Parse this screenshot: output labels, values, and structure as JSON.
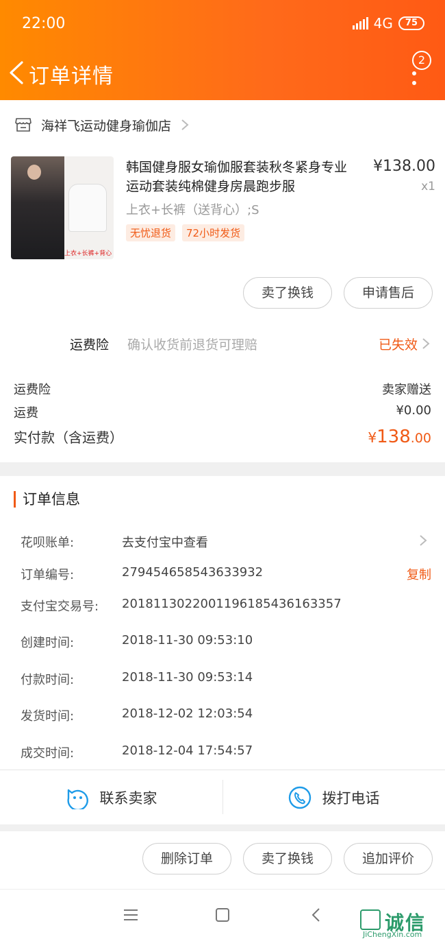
{
  "status_bar": {
    "time": "22:00",
    "network": "4G",
    "battery": "75"
  },
  "header": {
    "title": "订单详情",
    "menu_badge": "2"
  },
  "shop": {
    "name": "海祥飞运动健身瑜伽店"
  },
  "product": {
    "title": "韩国健身服女瑜伽服套装秋冬紧身专业运动套装纯棉健身房晨跑步服",
    "price": "¥138.00",
    "quantity": "x1",
    "spec": "上衣+长裤（送背心）;S",
    "tags": [
      "无忧退货",
      "72小时发货"
    ],
    "image_caption": "上衣+长裤+背心"
  },
  "product_actions": {
    "sell": "卖了换钱",
    "after_sale": "申请售后"
  },
  "insurance": {
    "label": "运费险",
    "desc": "确认收货前退货可理赔",
    "status": "已失效"
  },
  "fees": [
    {
      "label": "运费险",
      "value": "卖家赠送"
    },
    {
      "label": "运费",
      "value": "¥0.00"
    }
  ],
  "total": {
    "label": "实付款（含运费）",
    "currency": "¥",
    "integer": "138",
    "decimal": ".00"
  },
  "order_info": {
    "title": "订单信息",
    "huabei": {
      "label": "花呗账单:",
      "value": "去支付宝中查看"
    },
    "order_no": {
      "label": "订单编号:",
      "value": "279454658543633932",
      "action": "复制"
    },
    "alipay_no": {
      "label": "支付宝交易号:",
      "value": "2018113022001196185436163357"
    },
    "created": {
      "label": "创建时间:",
      "value": "2018-11-30 09:53:10"
    },
    "paid": {
      "label": "付款时间:",
      "value": "2018-11-30 09:53:14"
    },
    "shipped": {
      "label": "发货时间:",
      "value": "2018-12-02 12:03:54"
    },
    "completed": {
      "label": "成交时间:",
      "value": "2018-12-04 17:54:57"
    }
  },
  "contact": {
    "seller": "联系卖家",
    "call": "拨打电话"
  },
  "bottom_actions": {
    "delete": "删除订单",
    "sell": "卖了换钱",
    "review": "追加评价"
  },
  "watermark": {
    "text": "诚信",
    "url": "JiChengXin.com"
  },
  "colors": {
    "accent": "#f05a16",
    "header_start": "#ff8a00",
    "header_end": "#ff5a14",
    "icon_blue": "#1e9be8"
  }
}
